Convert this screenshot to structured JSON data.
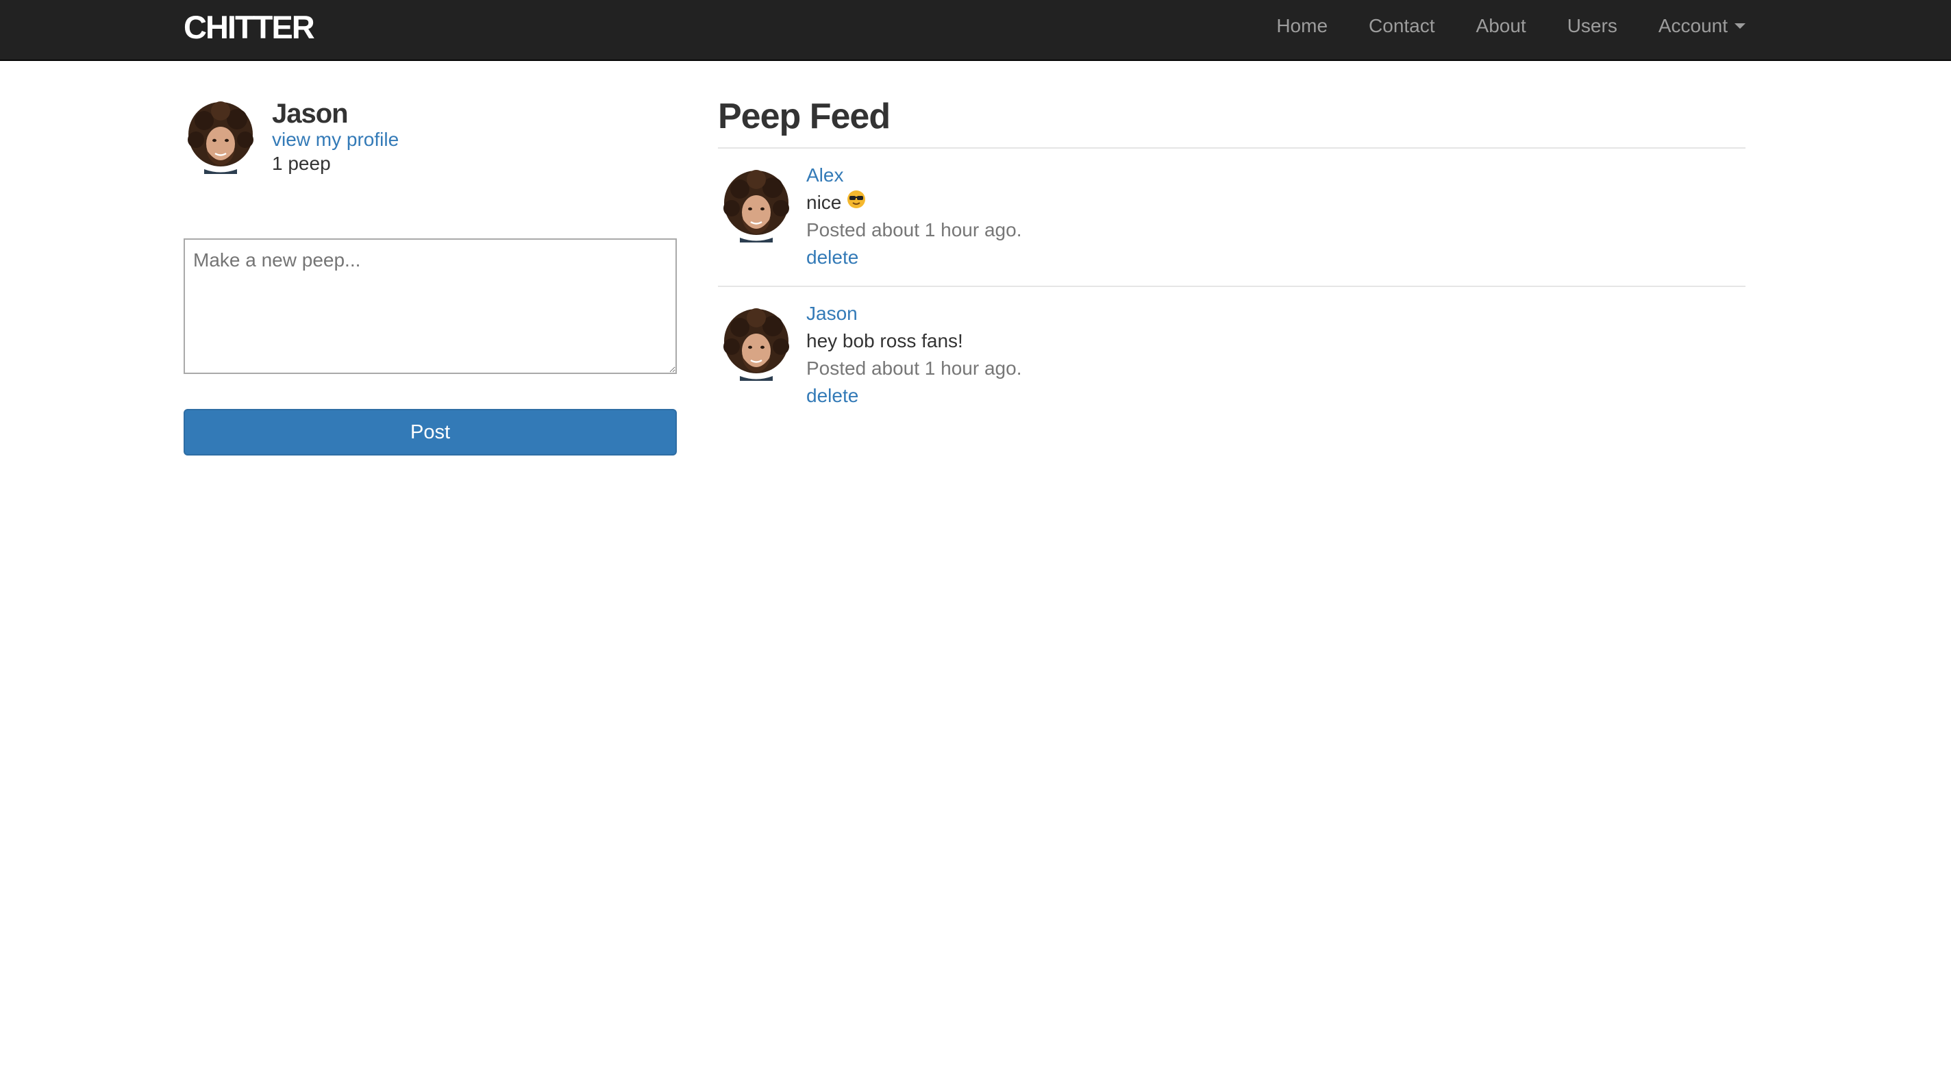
{
  "navbar": {
    "brand": "CHITTER",
    "items": [
      {
        "label": "Home"
      },
      {
        "label": "Contact"
      },
      {
        "label": "About"
      },
      {
        "label": "Users"
      },
      {
        "label": "Account"
      }
    ]
  },
  "profile": {
    "name": "Jason",
    "link_label": "view my profile",
    "count_label": "1 peep",
    "avatar_icon": "avatar-afro-portrait"
  },
  "composer": {
    "placeholder": "Make a new peep...",
    "value": "",
    "button_label": "Post"
  },
  "feed": {
    "title": "Peep Feed",
    "peeps": [
      {
        "author": "Alex",
        "text": "nice",
        "emoji": "sunglasses-emoji",
        "time": "Posted about 1 hour ago.",
        "delete_label": "delete"
      },
      {
        "author": "Jason",
        "text": "hey bob ross fans!",
        "time": "Posted about 1 hour ago.",
        "delete_label": "delete"
      }
    ]
  },
  "colors": {
    "navbar_bg": "#222222",
    "nav_text": "#9d9d9d",
    "link": "#337ab7",
    "button_bg": "#337ab7",
    "muted_text": "#777777"
  }
}
